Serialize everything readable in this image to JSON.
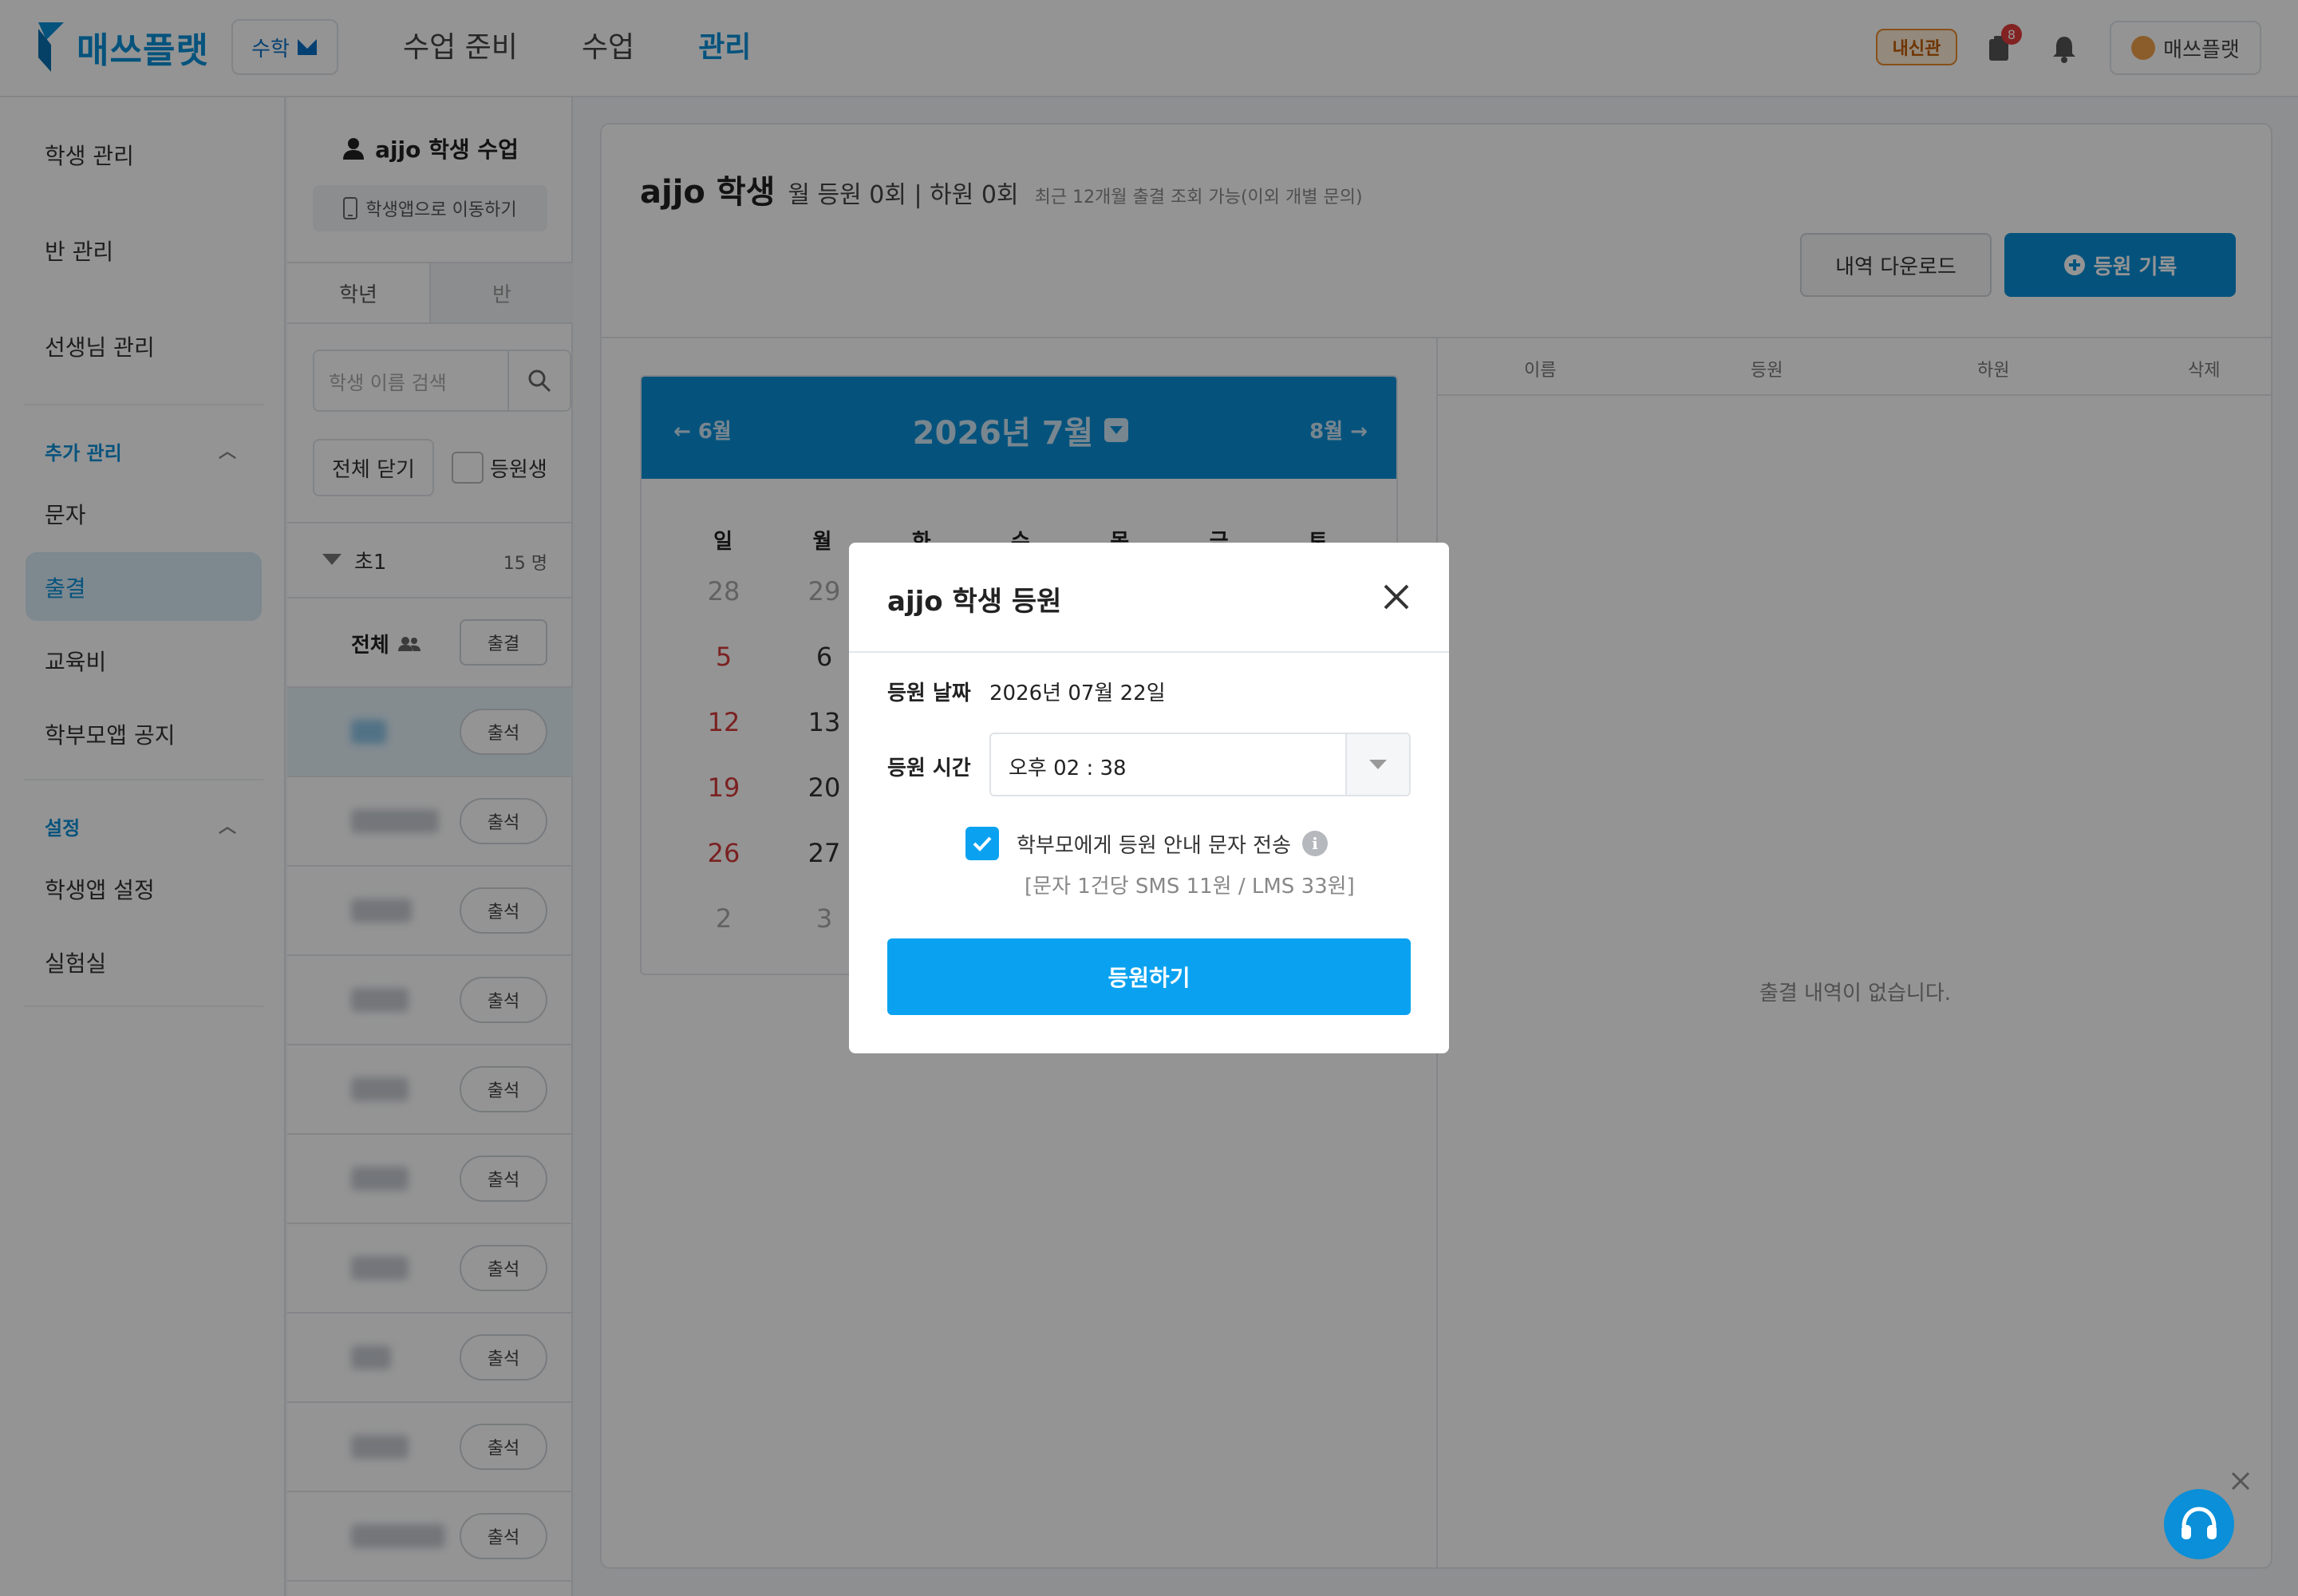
{
  "header": {
    "brand": "매쓰플랫",
    "subject": "수학",
    "nav": [
      {
        "label": "수업 준비"
      },
      {
        "label": "수업"
      },
      {
        "label": "관리"
      }
    ],
    "naesin_badge": "내신관",
    "notification_count": "8",
    "user_name": "매쓰플랫"
  },
  "sidebar": {
    "items_top": [
      "학생 관리",
      "반 관리",
      "선생님 관리"
    ],
    "section_extra": "추가 관리",
    "items_extra": [
      "문자",
      "출결",
      "교육비",
      "학부모앱 공지"
    ],
    "section_settings": "설정",
    "items_settings": [
      "학생앱 설정",
      "실험실"
    ]
  },
  "students": {
    "title": "ajjo 학생 수업",
    "app_button": "학생앱으로 이동하기",
    "tabs": [
      "학년",
      "반"
    ],
    "search_placeholder": "학생 이름 검색",
    "close_all": "전체 닫기",
    "enrolled_filter": "등원생",
    "grade": "초1",
    "grade_count": "15 명",
    "all_label": "전체",
    "all_button": "출결",
    "row_button": "출석"
  },
  "main": {
    "title": "ajjo 학생",
    "summary": "월 등원 0회 | 하원 0회",
    "note": "최근 12개월 출결 조회 가능(이외 개별 문의)",
    "download_button": "내역 다운로드",
    "record_button": "등원 기록",
    "calendar": {
      "prev": "6월",
      "title": "2026년 7월",
      "next": "8월",
      "weekdays": [
        "일",
        "월",
        "화",
        "수",
        "목",
        "금",
        "토"
      ],
      "weeks": [
        [
          "28",
          "29"
        ],
        [
          "5",
          "6"
        ],
        [
          "12",
          "13"
        ],
        [
          "19",
          "20"
        ],
        [
          "26",
          "27"
        ],
        [
          "2",
          "3"
        ]
      ]
    },
    "table": {
      "columns": [
        "이름",
        "등원",
        "하원",
        "삭제"
      ],
      "empty": "출결 내역이 없습니다."
    }
  },
  "modal": {
    "title": "ajjo 학생 등원",
    "date_label": "등원 날짜",
    "date_value": "2026년 07월 22일",
    "time_label": "등원 시간",
    "time_value": "오후 02 : 38",
    "sms_label": "학부모에게 등원 안내 문자 전송",
    "sms_price": "[문자 1건당 SMS 11원 / LMS 33원]",
    "submit": "등원하기"
  },
  "colors": {
    "brand": "#0a8fd8",
    "primary_button": "#0aa2f0",
    "sunday": "#d43a3a"
  }
}
